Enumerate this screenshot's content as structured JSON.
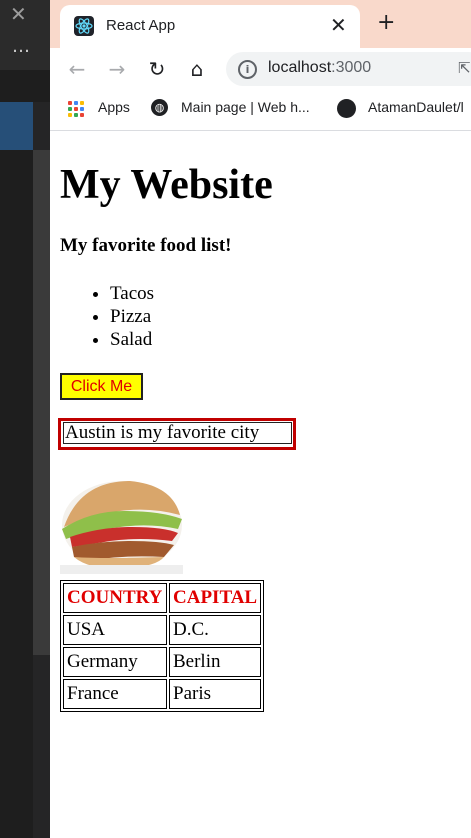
{
  "editor": {
    "close_glyph": "✕",
    "more_glyph": "…"
  },
  "browser": {
    "tab": {
      "title": "React App",
      "favicon": "react-icon",
      "close_glyph": "✕"
    },
    "new_tab_glyph": "+",
    "toolbar": {
      "back_glyph": "←",
      "forward_glyph": "→",
      "reload_glyph": "↻",
      "home_glyph": "⌂",
      "url_host": "localhost",
      "url_port": ":3000"
    },
    "bookmarks": [
      {
        "label": "Apps",
        "icon": "apps-grid-icon"
      },
      {
        "label": "Main page | Web h...",
        "icon": "globe-icon"
      },
      {
        "label": "AtamanDaulet/l",
        "icon": "github-icon"
      }
    ]
  },
  "page": {
    "title": "My Website",
    "food_heading": "My favorite food list!",
    "food_list": [
      "Tacos",
      "Pizza",
      "Salad"
    ],
    "button_label": "Click Me",
    "city_text": "Austin is my favorite city",
    "table": {
      "headers": [
        "COUNTRY",
        "CAPITAL"
      ],
      "rows": [
        [
          "USA",
          "D.C."
        ],
        [
          "Germany",
          "Berlin"
        ],
        [
          "France",
          "Paris"
        ]
      ]
    }
  },
  "colors": {
    "button_bg": "#ffff00",
    "button_text": "#e00000",
    "header_text": "#e00000",
    "city_border": "#c00000",
    "tab_strip": "#f9d9cb"
  }
}
